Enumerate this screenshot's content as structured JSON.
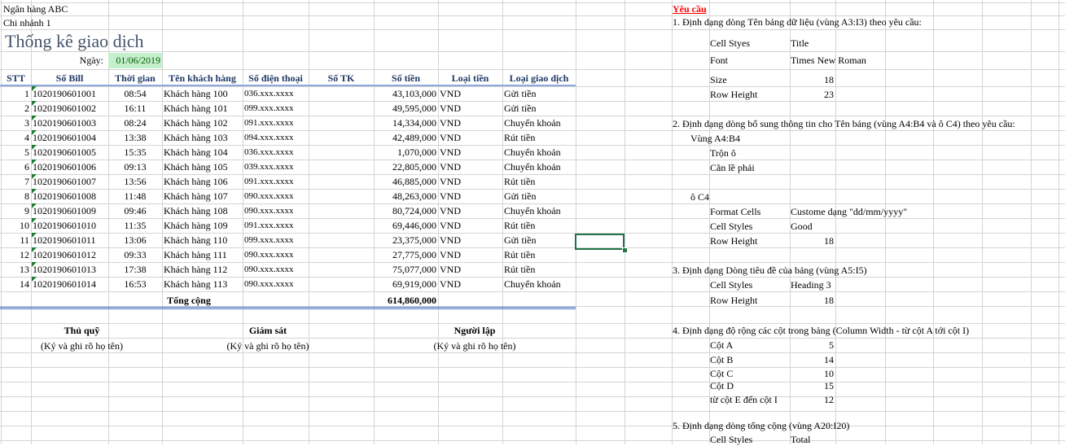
{
  "meta": {
    "bank": "Ngân hàng ABC",
    "branch": "Chi nhánh 1"
  },
  "title": "Thống kê giao dịch",
  "date": {
    "label": "Ngày:",
    "value": "01/06/2019",
    "fill_color": "#c6efce",
    "text_color": "#006100"
  },
  "headers": [
    "STT",
    "Số Bill",
    "Thời gian",
    "Tên khách hàng",
    "Số điện thoại",
    "Số TK",
    "Số tiền",
    "Loại tiền",
    "Loại giao dịch"
  ],
  "rows": [
    [
      "1",
      "1020190601001",
      "08:54",
      "Khách hàng 100",
      "036.xxx.xxxx",
      "",
      "43,103,000",
      "VND",
      "Gửi tiền"
    ],
    [
      "2",
      "1020190601002",
      "16:11",
      "Khách hàng 101",
      "099.xxx.xxxx",
      "",
      "49,595,000",
      "VND",
      "Gửi tiền"
    ],
    [
      "3",
      "1020190601003",
      "08:24",
      "Khách hàng 102",
      "091.xxx.xxxx",
      "",
      "14,334,000",
      "VND",
      "Chuyển khoản"
    ],
    [
      "4",
      "1020190601004",
      "13:38",
      "Khách hàng 103",
      "094.xxx.xxxx",
      "",
      "42,489,000",
      "VND",
      "Rút tiền"
    ],
    [
      "5",
      "1020190601005",
      "15:35",
      "Khách hàng 104",
      "036.xxx.xxxx",
      "",
      "1,070,000",
      "VND",
      "Chuyển khoản"
    ],
    [
      "6",
      "1020190601006",
      "09:13",
      "Khách hàng 105",
      "039.xxx.xxxx",
      "",
      "22,805,000",
      "VND",
      "Chuyển khoản"
    ],
    [
      "7",
      "1020190601007",
      "13:56",
      "Khách hàng 106",
      "091.xxx.xxxx",
      "",
      "46,885,000",
      "VND",
      "Rút tiền"
    ],
    [
      "8",
      "1020190601008",
      "11:48",
      "Khách hàng 107",
      "090.xxx.xxxx",
      "",
      "48,263,000",
      "VND",
      "Gửi tiền"
    ],
    [
      "9",
      "1020190601009",
      "09:46",
      "Khách hàng 108",
      "090.xxx.xxxx",
      "",
      "80,724,000",
      "VND",
      "Chuyển khoản"
    ],
    [
      "10",
      "1020190601010",
      "11:35",
      "Khách hàng 109",
      "091.xxx.xxxx",
      "",
      "69,446,000",
      "VND",
      "Rút tiền"
    ],
    [
      "11",
      "1020190601011",
      "13:06",
      "Khách hàng 110",
      "099.xxx.xxxx",
      "",
      "23,375,000",
      "VND",
      "Gửi tiền"
    ],
    [
      "12",
      "1020190601012",
      "09:33",
      "Khách hàng 111",
      "090.xxx.xxxx",
      "",
      "27,775,000",
      "VND",
      "Rút tiền"
    ],
    [
      "13",
      "1020190601013",
      "17:38",
      "Khách hàng 112",
      "090.xxx.xxxx",
      "",
      "75,077,000",
      "VND",
      "Rút tiền"
    ],
    [
      "14",
      "1020190601014",
      "16:53",
      "Khách hàng 113",
      "090.xxx.xxxx",
      "",
      "69,919,000",
      "VND",
      "Chuyển khoản"
    ]
  ],
  "total": {
    "label": "Tổng cộng",
    "value": "614,860,000"
  },
  "signatures": [
    {
      "title": "Thủ quỹ",
      "note": "(Ký và ghi rõ họ tên)"
    },
    {
      "title": "Giám sát",
      "note": "(Ký và ghi rõ họ tên)"
    },
    {
      "title": "Người lập",
      "note": "(Ký và ghi rõ họ tên)"
    }
  ],
  "requirements": {
    "heading": "Yêu cầu",
    "s1": {
      "title": "1. Định dạng dòng Tên bảng dữ liệu (vùng A3:I3) theo yêu cầu:",
      "items": [
        {
          "label": "Cell Styes",
          "value": "Title"
        },
        {
          "label": "Font",
          "value": "Times New Roman"
        },
        {
          "label": "Size",
          "value": "18"
        },
        {
          "label": "Row Height",
          "value": "23"
        }
      ]
    },
    "s2": {
      "title": "2. Định dạng dòng bổ sung thông tin cho Tên bảng (vùng A4:B4 và ô C4) theo yêu cầu:",
      "range1": "Vùng A4:B4",
      "range1_items": [
        "Trộn ô",
        "Căn lề phải"
      ],
      "range2": "ô C4",
      "items": [
        {
          "label": "Format Cells",
          "value": "Custome dạng \"dd/mm/yyyy\""
        },
        {
          "label": "Cell Styles",
          "value": "Good"
        },
        {
          "label": "Row Height",
          "value": "18"
        }
      ]
    },
    "s3": {
      "title": "3. Định dạng Dòng tiêu đề của bảng (vùng A5:I5)",
      "items": [
        {
          "label": "Cell Styles",
          "value": "Heading 3"
        },
        {
          "label": "Row Height",
          "value": "18"
        }
      ]
    },
    "s4": {
      "title": "4. Định dạng độ rộng các cột trong bảng (Column Width - từ cột A tới cột I)",
      "items": [
        {
          "label": "Cột A",
          "value": "5"
        },
        {
          "label": "Cột B",
          "value": "14"
        },
        {
          "label": "Cột C",
          "value": "10"
        },
        {
          "label": "Cột D",
          "value": "15"
        },
        {
          "label": "từ cột E đến cột I",
          "value": "12"
        }
      ]
    },
    "s5": {
      "title": "5. Định dạng dòng tổng cộng (vùng A20:I20)",
      "items": [
        {
          "label": "Cell Styles",
          "value": "Total"
        }
      ]
    }
  },
  "colors": {
    "header_border": "#8ea9db",
    "header_text": "#1f3864",
    "selection": "#217346",
    "required": "#ff0000"
  }
}
